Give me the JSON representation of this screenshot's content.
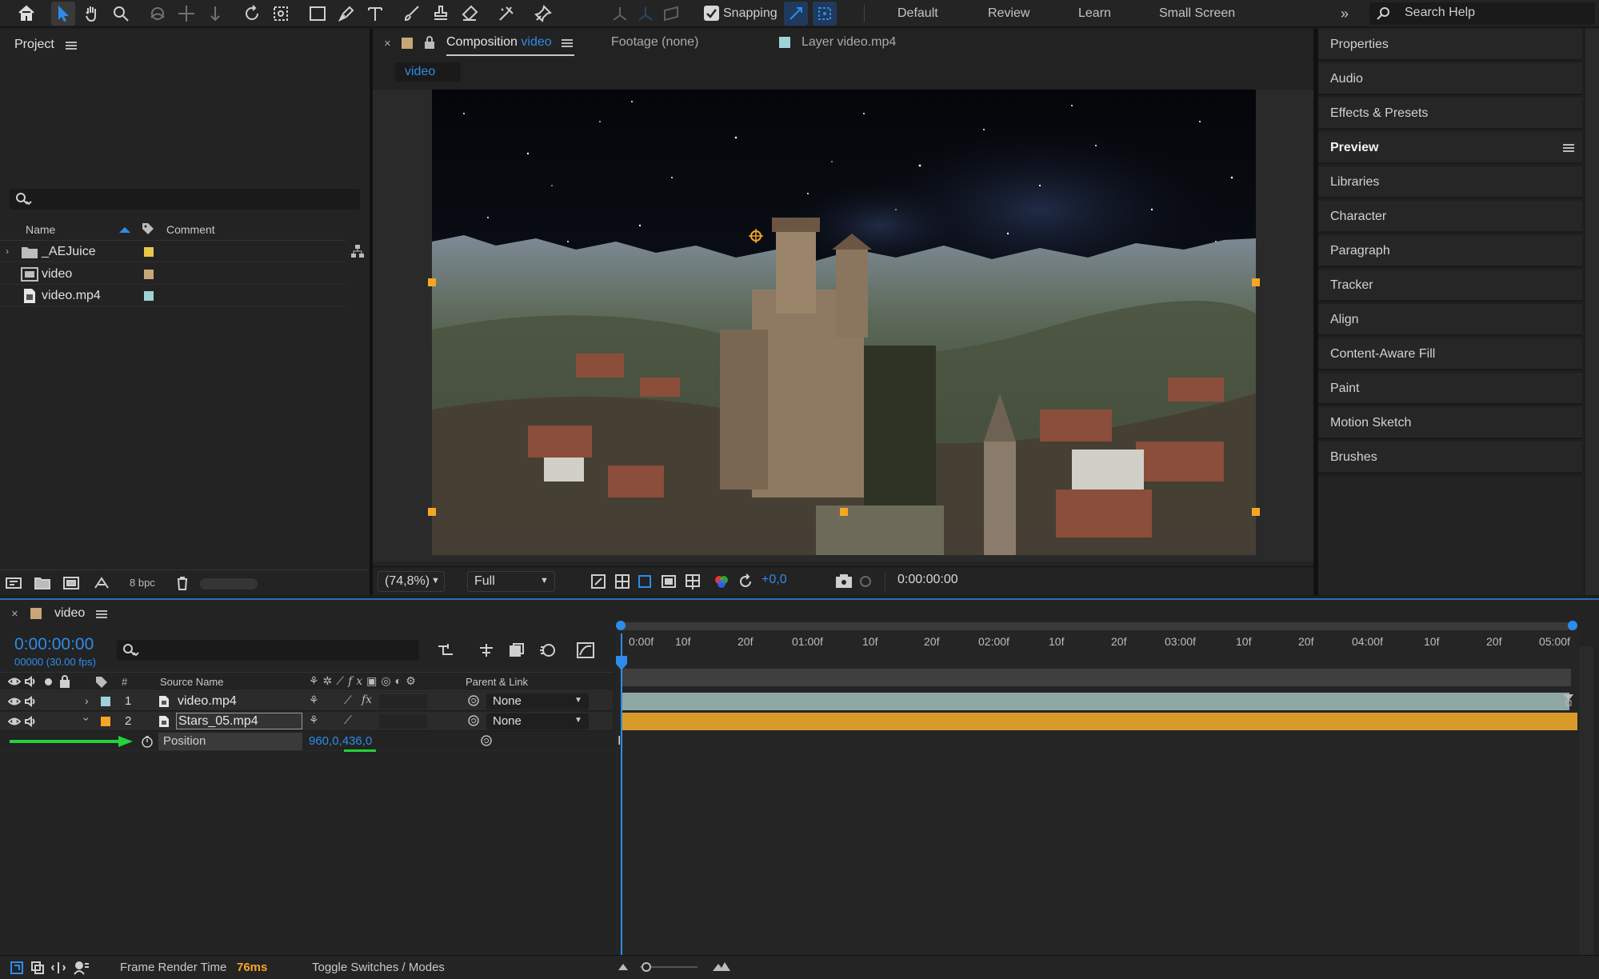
{
  "toolbar": {
    "snapping_label": "Snapping",
    "workspaces": [
      "Default",
      "Review",
      "Learn",
      "Small Screen"
    ],
    "search_placeholder": "Search Help",
    "tools": [
      "home-icon",
      "selection-tool-icon",
      "hand-tool-icon",
      "zoom-tool-icon",
      "orbit-camera-icon",
      "pan-camera-icon",
      "dolly-camera-icon",
      "rotate-tool-icon",
      "pan-behind-icon",
      "rectangle-tool-icon",
      "pen-tool-icon",
      "type-tool-icon",
      "brush-tool-icon",
      "clone-stamp-icon",
      "eraser-icon",
      "roto-brush-icon",
      "puppet-pin-icon"
    ]
  },
  "project": {
    "title": "Project",
    "search_placeholder": "",
    "columns": {
      "name": "Name",
      "comment": "Comment"
    },
    "items": [
      {
        "name": "_AEJuice",
        "type": "folder",
        "label_color": "#e6c84a"
      },
      {
        "name": "video",
        "type": "composition",
        "label_color": "#c9a67a"
      },
      {
        "name": "video.mp4",
        "type": "footage",
        "label_color": "#9fd3d6"
      }
    ],
    "footer": {
      "bpc": "8 bpc"
    }
  },
  "viewer": {
    "tabs": [
      {
        "label": "Composition",
        "highlight": "video"
      },
      {
        "label": "Footage (none)"
      },
      {
        "label": "Layer video.mp4"
      }
    ],
    "comp_tab": "video",
    "footer": {
      "zoom": "(74,8%)",
      "resolution": "Full",
      "exposure": "+0,0",
      "timecode": "0:00:00:00"
    }
  },
  "right_panel": {
    "items": [
      "Properties",
      "Audio",
      "Effects & Presets",
      "Preview",
      "Libraries",
      "Character",
      "Paragraph",
      "Tracker",
      "Align",
      "Content-Aware Fill",
      "Paint",
      "Motion Sketch",
      "Brushes"
    ],
    "active": "Preview"
  },
  "timeline": {
    "comp_name": "video",
    "current_time": "0:00:00:00",
    "frame_info": "00000 (30.00 fps)",
    "columns": {
      "hash": "#",
      "source_name": "Source Name",
      "parent": "Parent & Link"
    },
    "layers": [
      {
        "index": "1",
        "name": "video.mp4",
        "label_color": "#9fd3d6",
        "parent": "None",
        "bar_color": "#8fa8a3"
      },
      {
        "index": "2",
        "name": "Stars_05.mp4",
        "label_color": "#f5a623",
        "parent": "None",
        "bar_color": "#d99a2b"
      }
    ],
    "property": {
      "name": "Position",
      "value_x": "960,0",
      "value_y": "436,0"
    },
    "ruler_labels": [
      "0:00f",
      "10f",
      "20f",
      "01:00f",
      "10f",
      "20f",
      "02:00f",
      "10f",
      "20f",
      "03:00f",
      "10f",
      "20f",
      "04:00f",
      "10f",
      "20f",
      "05:00f"
    ],
    "footer": {
      "render_time_label": "Frame Render Time",
      "render_time_value": "76ms",
      "toggle_label": "Toggle Switches / Modes"
    }
  },
  "colors": {
    "accent_blue": "#2d8ceb",
    "annotation_green": "#22d33a",
    "handle_orange": "#f5a623"
  }
}
